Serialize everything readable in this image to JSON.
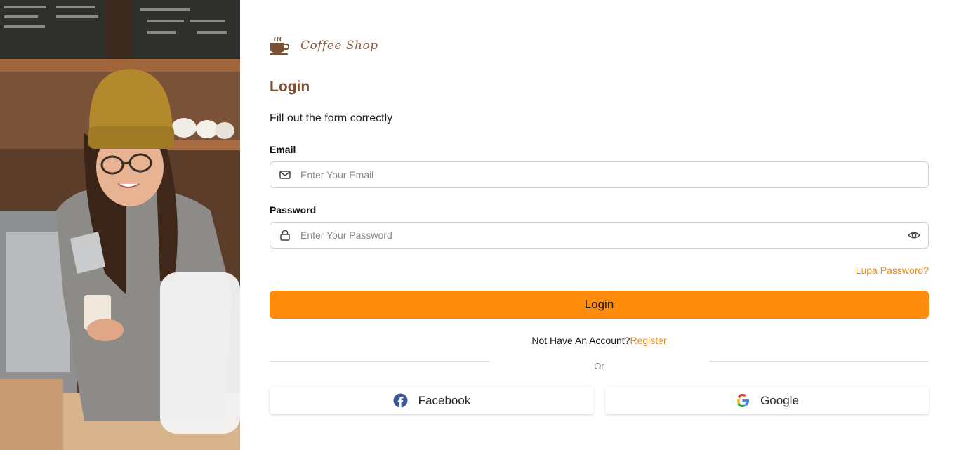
{
  "brand": {
    "name": "Coffee Shop",
    "icon": "coffee-cup-icon"
  },
  "form": {
    "title": "Login",
    "subtitle": "Fill out the form correctly",
    "email": {
      "label": "Email",
      "placeholder": "Enter Your Email",
      "value": "",
      "icon": "mail-icon"
    },
    "password": {
      "label": "Password",
      "placeholder": "Enter Your Password",
      "value": "",
      "icon": "lock-icon",
      "toggle_icon": "eye-icon"
    },
    "forgot_link": "Lupa Password?",
    "submit_label": "Login",
    "signup_prompt": "Not Have An Account?",
    "signup_link": "Register",
    "divider_text": "Or"
  },
  "social": [
    {
      "label": "Facebook",
      "icon": "facebook-icon"
    },
    {
      "label": "Google",
      "icon": "google-icon"
    }
  ],
  "colors": {
    "accent": "#ff8a0b",
    "link": "#f28a0b",
    "title_brown": "#7b4f2f",
    "brand_brown": "#8b5a3c"
  }
}
